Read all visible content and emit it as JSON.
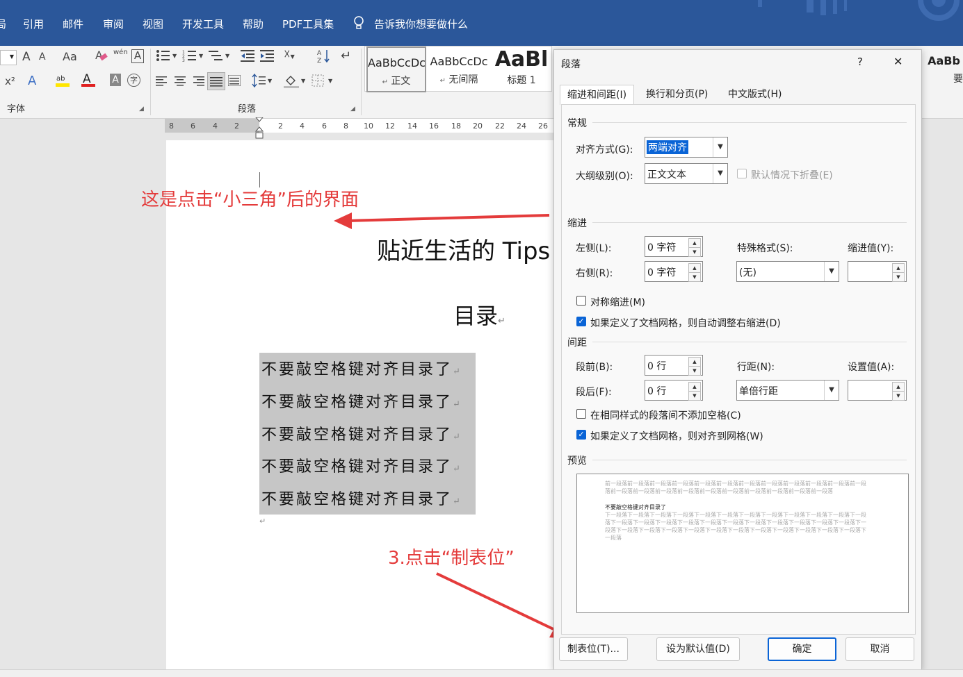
{
  "ribbon_tabs": [
    "局",
    "引用",
    "邮件",
    "审阅",
    "视图",
    "开发工具",
    "帮助",
    "PDF工具集"
  ],
  "tell_me": "告诉我你想要做什么",
  "font_group": {
    "label": "字体",
    "grow": "A",
    "shrink": "A",
    "change_case": "Aa",
    "phonetic": "wén",
    "superscript": "x²",
    "highlight": "ab",
    "font_color": "A"
  },
  "paragraph_group": {
    "label": "段落"
  },
  "styles": [
    {
      "preview": "AaBbCcDc",
      "name": "正文"
    },
    {
      "preview": "AaBbCcDc",
      "name": "无间隔"
    },
    {
      "preview": "AaBl",
      "name": "标题 1"
    },
    {
      "preview": "AaBb",
      "name": "要"
    }
  ],
  "paragraph_marks": {
    "mark": "↵"
  },
  "ruler": [
    "8",
    "6",
    "4",
    "2",
    "2",
    "4",
    "6",
    "8",
    "10",
    "12",
    "14",
    "16",
    "18",
    "20",
    "22",
    "24",
    "26"
  ],
  "document": {
    "title": "贴近生活的 Tips",
    "toc_heading": "目录",
    "toc_lines": [
      "不要敲空格键对齐目录了",
      "不要敲空格键对齐目录了",
      "不要敲空格键对齐目录了",
      "不要敲空格键对齐目录了",
      "不要敲空格键对齐目录了"
    ]
  },
  "annotations": {
    "note1": "这是点击“小三角”后的界面",
    "note2": "3.点击“制表位”",
    "color": "#e43b3b"
  },
  "dialog": {
    "title": "段落",
    "help": "?",
    "close": "✕",
    "tabs": [
      "缩进和间距(I)",
      "换行和分页(P)",
      "中文版式(H)"
    ],
    "general": {
      "heading": "常规",
      "alignment_label": "对齐方式(G):",
      "alignment_value": "两端对齐",
      "outline_label": "大纲级别(O):",
      "outline_value": "正文文本",
      "collapse_label": "默认情况下折叠(E)"
    },
    "indent": {
      "heading": "缩进",
      "left_label": "左侧(L):",
      "left_value": "0 字符",
      "right_label": "右侧(R):",
      "right_value": "0 字符",
      "special_label": "特殊格式(S):",
      "special_value": "(无)",
      "by_label": "缩进值(Y):",
      "mirror_label": "对称缩进(M)",
      "auto_adjust_label": "如果定义了文档网格，则自动调整右缩进(D)"
    },
    "spacing": {
      "heading": "间距",
      "before_label": "段前(B):",
      "before_value": "0 行",
      "after_label": "段后(F):",
      "after_value": "0 行",
      "line_label": "行距(N):",
      "line_value": "单倍行距",
      "at_label": "设置值(A):",
      "no_space_label": "在相同样式的段落间不添加空格(C)",
      "snap_grid_label": "如果定义了文档网格，则对齐到网格(W)"
    },
    "preview": {
      "heading": "预览",
      "prev_text": "前一段落前一段落前一段落前一段落前一段落前一段落前一段落前一段落前一段落前一段落前一段落前一段落前一段落前一段落前一段落前一段落前一段落前一段落前一段落前一段落前一段落前一段落",
      "sample_text": "不要敲空格键对齐目录了",
      "next_text": "下一段落下一段落下一段落下一段落下一段落下一段落下一段落下一段落下一段落下一段落下一段落下一段落下一段落下一段落下一段落下一段落下一段落下一段落下一段落下一段落下一段落下一段落下一段落下一段落下一段落下一段落下一段落下一段落下一段落下一段落下一段落下一段落下一段落下一段落下一段落下一段落"
    },
    "buttons": {
      "tabs": "制表位(T)...",
      "default": "设为默认值(D)",
      "ok": "确定",
      "cancel": "取消"
    },
    "accent": "#0a64d6"
  }
}
